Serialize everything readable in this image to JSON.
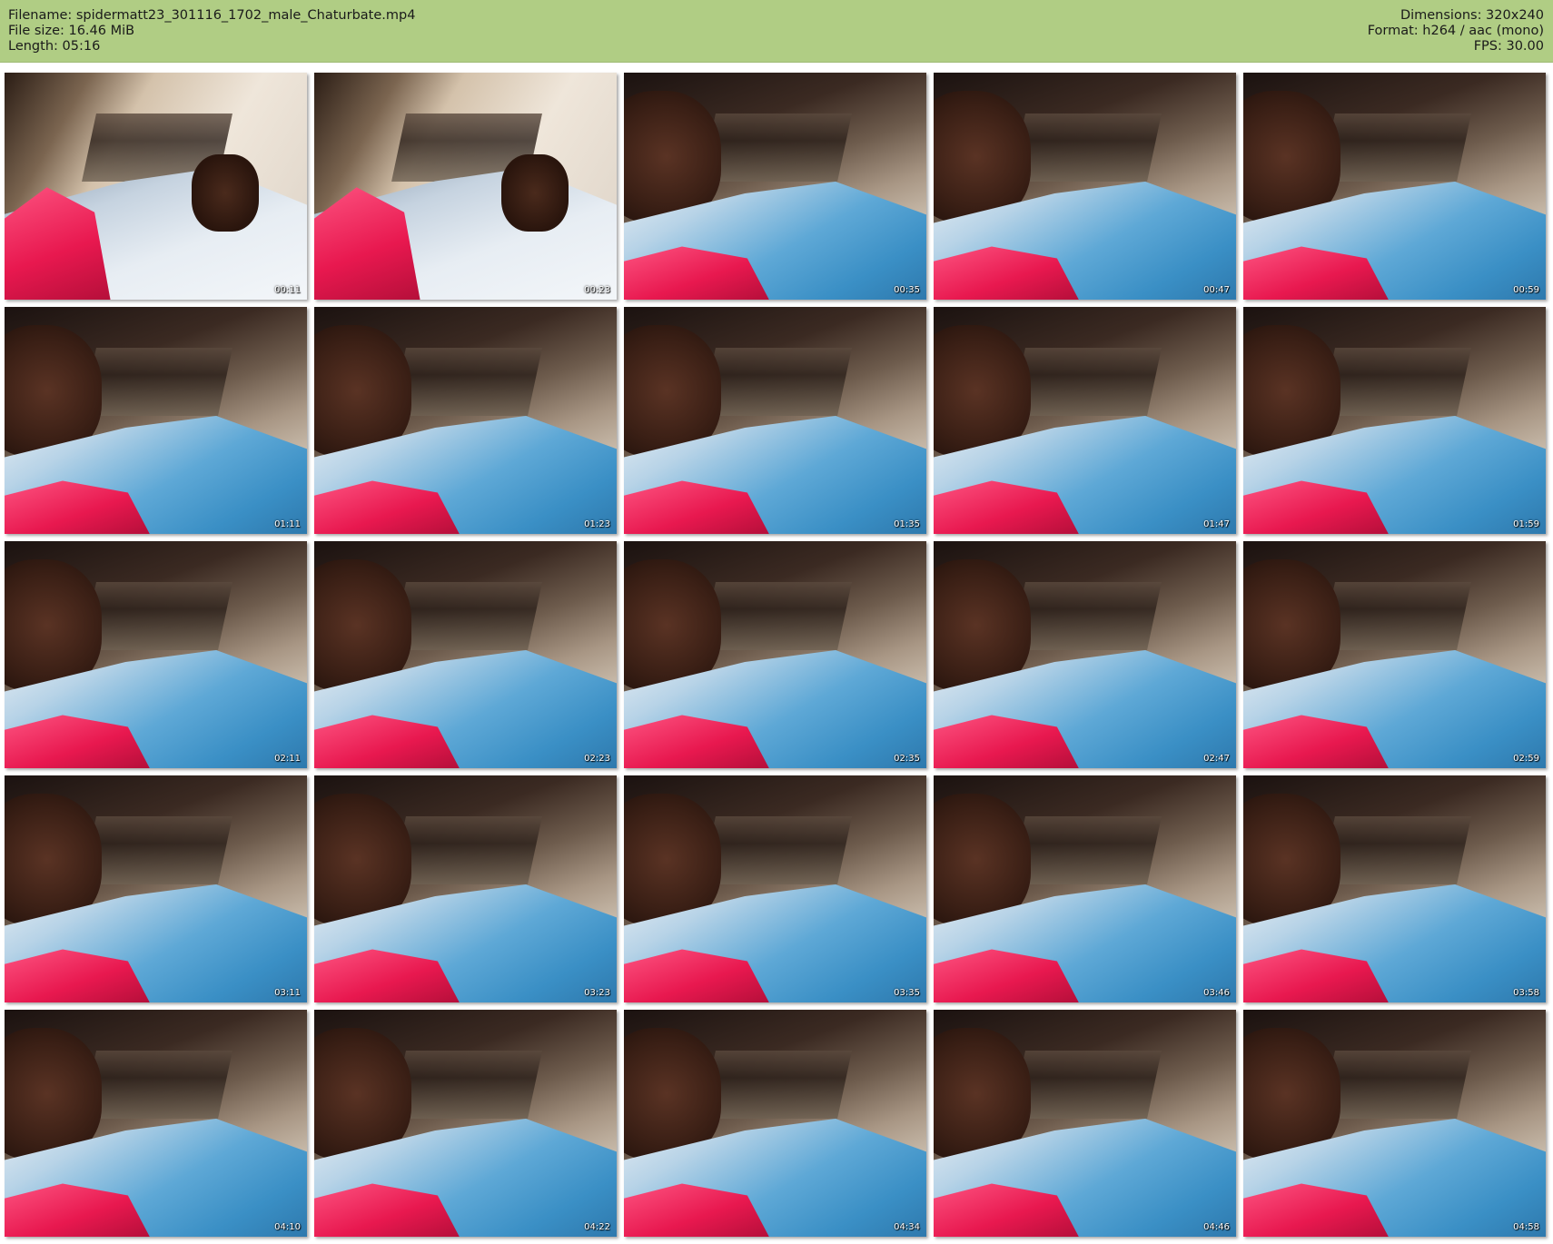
{
  "header": {
    "filename_line": "Filename: spidermatt23_301116_1702_male_Chaturbate.mp4",
    "filesize_line": "File size: 16.46 MiB",
    "length_line": "Length: 05:16",
    "dimensions_line": "Dimensions: 320x240",
    "format_line": "Format: h264 / aac (mono)",
    "fps_line": "FPS: 30.00",
    "background_color": "#b0cd84"
  },
  "thumbnails": [
    {
      "timestamp": "00:11"
    },
    {
      "timestamp": "00:23"
    },
    {
      "timestamp": "00:35"
    },
    {
      "timestamp": "00:47"
    },
    {
      "timestamp": "00:59"
    },
    {
      "timestamp": "01:11"
    },
    {
      "timestamp": "01:23"
    },
    {
      "timestamp": "01:35"
    },
    {
      "timestamp": "01:47"
    },
    {
      "timestamp": "01:59"
    },
    {
      "timestamp": "02:11"
    },
    {
      "timestamp": "02:23"
    },
    {
      "timestamp": "02:35"
    },
    {
      "timestamp": "02:47"
    },
    {
      "timestamp": "02:59"
    },
    {
      "timestamp": "03:11"
    },
    {
      "timestamp": "03:23"
    },
    {
      "timestamp": "03:35"
    },
    {
      "timestamp": "03:46"
    },
    {
      "timestamp": "03:58"
    },
    {
      "timestamp": "04:10"
    },
    {
      "timestamp": "04:22"
    },
    {
      "timestamp": "04:34"
    },
    {
      "timestamp": "04:46"
    },
    {
      "timestamp": "04:58"
    }
  ]
}
